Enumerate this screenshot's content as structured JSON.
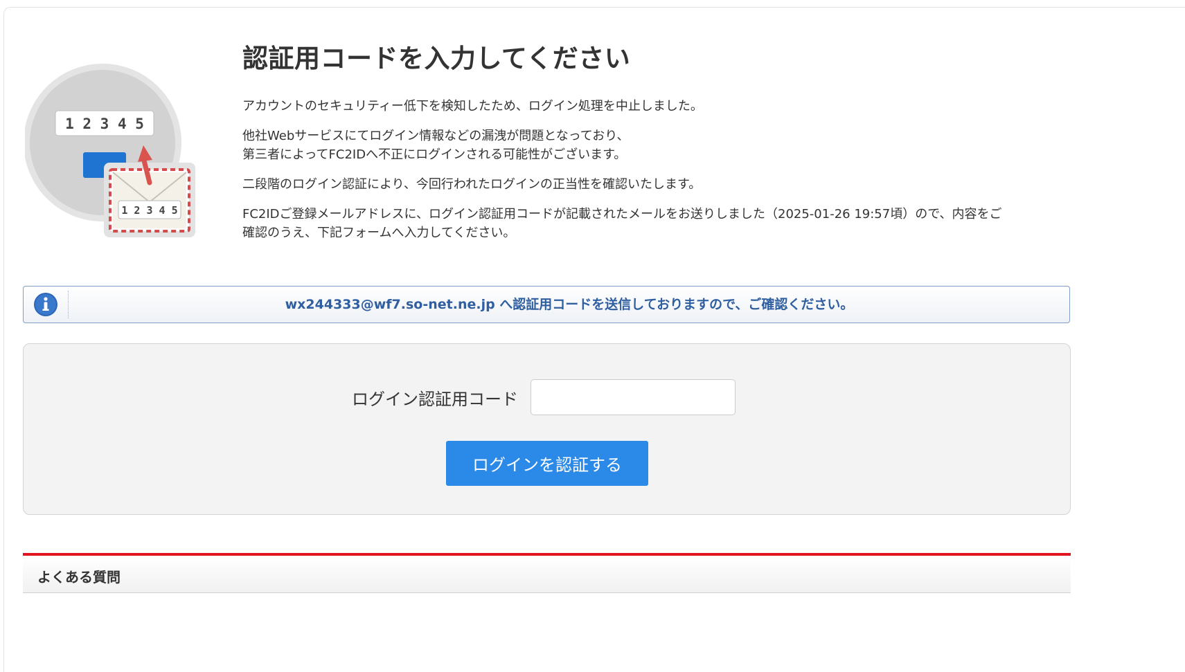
{
  "header": {
    "title": "認証用コードを入力してください"
  },
  "illustration": {
    "screen_code": "1 2 3 4 5",
    "envelope_code": "1 2 3 4 5"
  },
  "description": {
    "line1": "アカウントのセキュリティー低下を検知したため、ログイン処理を中止しました。",
    "line2a": "他社Webサービスにてログイン情報などの漏洩が問題となっており、",
    "line2b": "第三者によってFC2IDへ不正にログインされる可能性がございます。",
    "line3": "二段階のログイン認証により、今回行われたログインの正当性を確認いたします。",
    "line4a": "FC2IDご登録メールアドレスに、ログイン認証用コードが記載されたメールをお送りしました（2025-01-26 19:57頃）ので、内容をご",
    "line4b": "確認のうえ、下記フォームへ入力してください。"
  },
  "info": {
    "message": "wx244333@wf7.so-net.ne.jp へ認証用コードを送信しておりますので、ご確認ください。",
    "icon": "info-icon",
    "color": "#2f5fa0"
  },
  "form": {
    "code_label": "ログイン認証用コード",
    "code_value": "",
    "submit_label": "ログインを認証する",
    "button_color": "#2b89e8"
  },
  "faq": {
    "title": "よくある質問",
    "accent_color": "#e0141e"
  }
}
